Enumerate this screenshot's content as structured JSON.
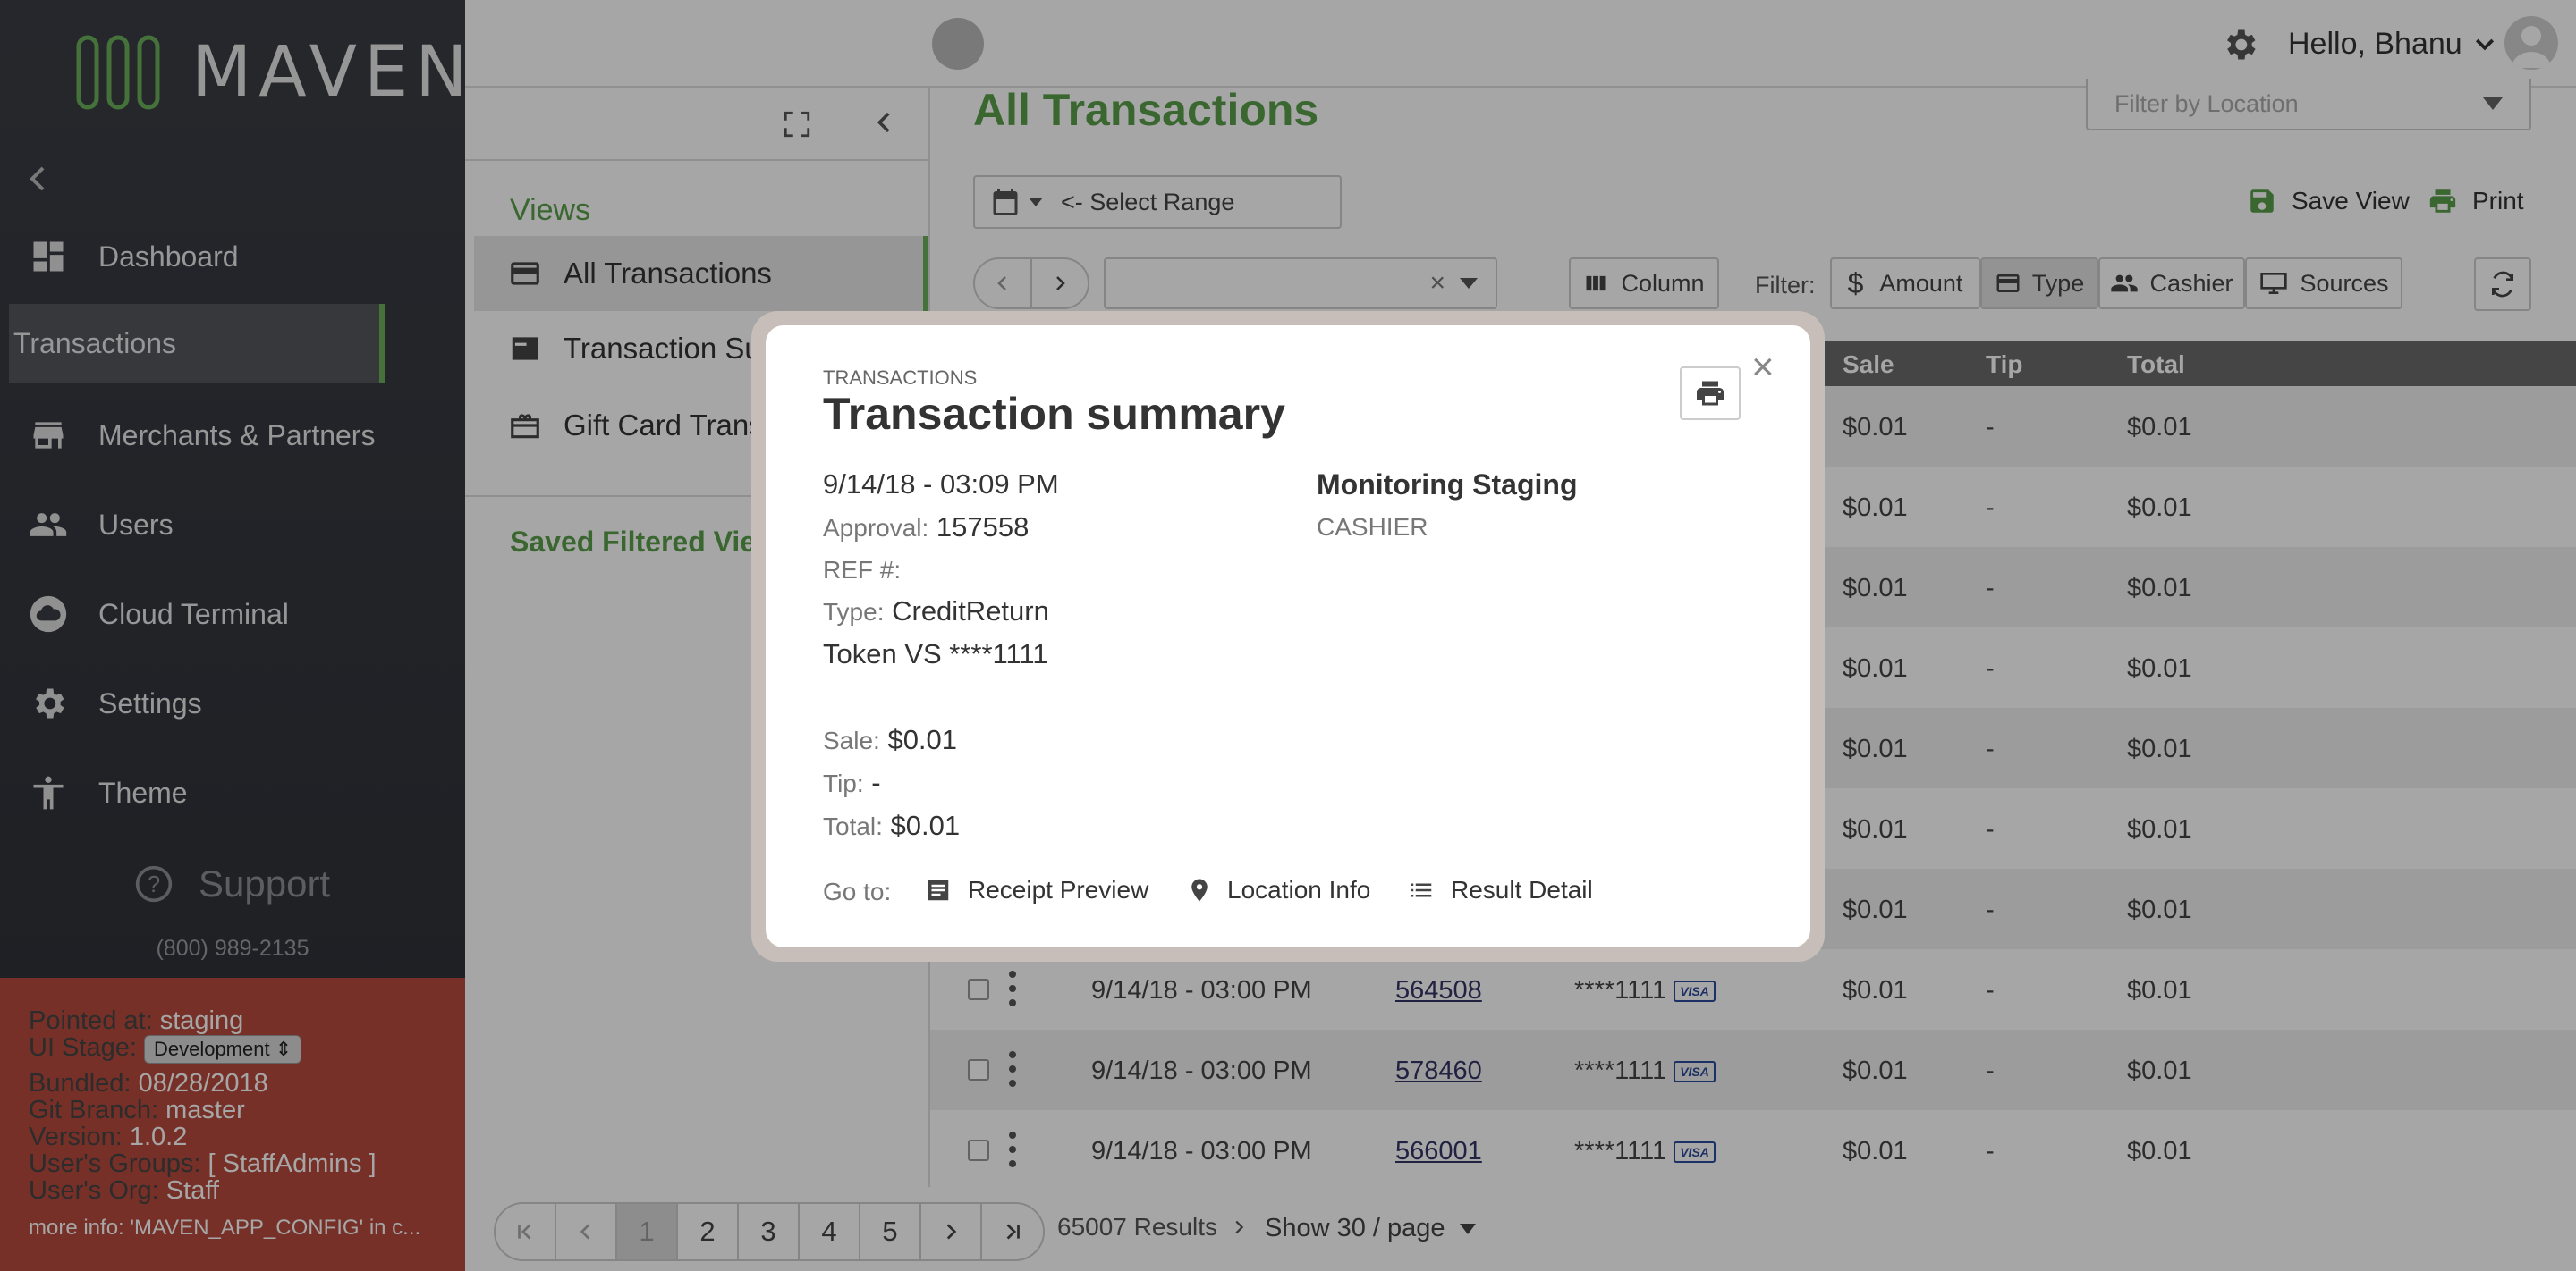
{
  "brand": {
    "name": "MAVEN",
    "accent": "#6aaf5a"
  },
  "sidebar": {
    "items": [
      {
        "label": "Dashboard",
        "icon": "dashboard-icon"
      },
      {
        "label": "Transactions",
        "icon": "none"
      },
      {
        "label": "Merchants & Partners",
        "icon": "store-icon"
      },
      {
        "label": "Users",
        "icon": "users-icon"
      },
      {
        "label": "Cloud Terminal",
        "icon": "cloud-icon"
      },
      {
        "label": "Settings",
        "icon": "gear-icon"
      },
      {
        "label": "Theme",
        "icon": "accessibility-icon"
      }
    ],
    "support_label": "Support",
    "phone": "(800) 989-2135",
    "debug": {
      "pointed_at_label": "Pointed at:",
      "pointed_at": "staging",
      "ui_stage_label": "UI Stage:",
      "ui_stage": "Development",
      "bundled_label": "Bundled:",
      "bundled": "08/28/2018",
      "git_branch_label": "Git Branch:",
      "git_branch": "master",
      "version_label": "Version:",
      "version": "1.0.2",
      "groups_label": "User's Groups:",
      "groups": "[ StaffAdmins ]",
      "org_label": "User's Org:",
      "org": "Staff",
      "more_info": "more info: 'MAVEN_APP_CONFIG' in c..."
    }
  },
  "header": {
    "greeting": "Hello, Bhanu"
  },
  "views": {
    "title": "Views",
    "items": [
      "All Transactions",
      "Transaction Su",
      "Gift Card Trans"
    ],
    "saved_title": "Saved Filtered Vie"
  },
  "main": {
    "title": "All Transactions",
    "location_placeholder": "Filter by Location",
    "select_range": "<- Select Range",
    "save_view": "Save View",
    "print": "Print",
    "column_btn": "Column",
    "filter_label": "Filter:",
    "filters": [
      "Amount",
      "Type",
      "Cashier",
      "Sources"
    ],
    "table_headers": [
      "Sale",
      "Tip",
      "Total"
    ],
    "rows": [
      {
        "date": "",
        "approval": "",
        "card": "",
        "sale": "$0.01",
        "tip": "-",
        "total": "$0.01"
      },
      {
        "date": "",
        "approval": "",
        "card": "",
        "sale": "$0.01",
        "tip": "-",
        "total": "$0.01"
      },
      {
        "date": "",
        "approval": "",
        "card": "",
        "sale": "$0.01",
        "tip": "-",
        "total": "$0.01"
      },
      {
        "date": "",
        "approval": "",
        "card": "",
        "sale": "$0.01",
        "tip": "-",
        "total": "$0.01"
      },
      {
        "date": "",
        "approval": "",
        "card": "",
        "sale": "$0.01",
        "tip": "-",
        "total": "$0.01"
      },
      {
        "date": "",
        "approval": "",
        "card": "",
        "sale": "$0.01",
        "tip": "-",
        "total": "$0.01"
      },
      {
        "date": "",
        "approval": "",
        "card": "",
        "sale": "$0.01",
        "tip": "-",
        "total": "$0.01"
      },
      {
        "date": "9/14/18 - 03:00 PM",
        "approval": "564508",
        "card": "****1111",
        "sale": "$0.01",
        "tip": "-",
        "total": "$0.01"
      },
      {
        "date": "9/14/18 - 03:00 PM",
        "approval": "578460",
        "card": "****1111",
        "sale": "$0.01",
        "tip": "-",
        "total": "$0.01"
      },
      {
        "date": "9/14/18 - 03:00 PM",
        "approval": "566001",
        "card": "****1111",
        "sale": "$0.01",
        "tip": "-",
        "total": "$0.01"
      }
    ],
    "visa_label": "VISA",
    "pages": [
      "1",
      "2",
      "3",
      "4",
      "5"
    ],
    "results": "65007 Results",
    "show_per_page": "Show 30 / page"
  },
  "modal": {
    "kicker": "TRANSACTIONS",
    "title": "Transaction summary",
    "datetime": "9/14/18 - 03:09 PM",
    "approval_label": "Approval:",
    "approval": "157558",
    "ref_label": "REF #:",
    "type_label": "Type:",
    "type": "CreditReturn",
    "token": "Token VS ****1111",
    "sale_label": "Sale:",
    "sale": "$0.01",
    "tip_label": "Tip:",
    "tip": "-",
    "total_label": "Total:",
    "total": "$0.01",
    "merchant": "Monitoring Staging",
    "role": "CASHIER",
    "goto_label": "Go to:",
    "links": [
      "Receipt Preview",
      "Location Info",
      "Result Detail"
    ]
  }
}
